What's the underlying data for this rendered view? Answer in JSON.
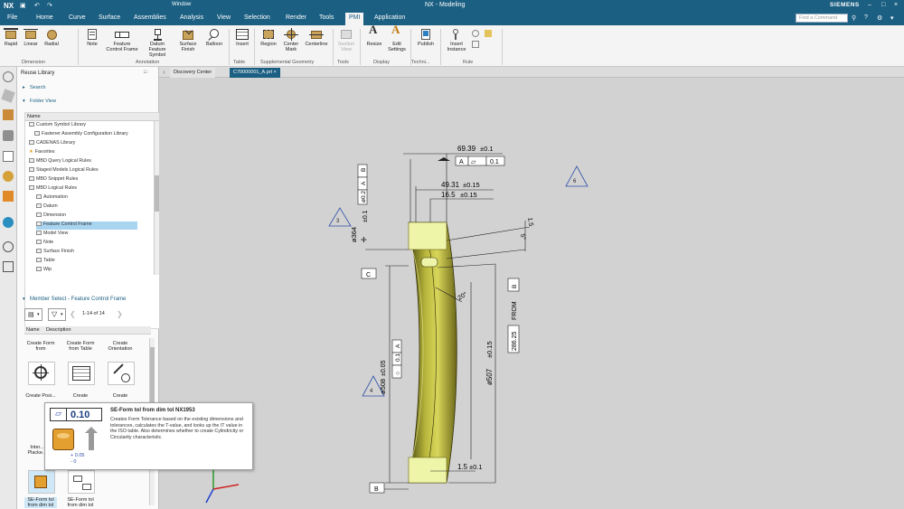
{
  "app": {
    "logo": "NX",
    "window_menu": "Window",
    "title": "NX - Modeling",
    "brand": "SIEMENS",
    "search_placeholder": "Find a Command"
  },
  "menu": [
    "File",
    "Home",
    "Curve",
    "Surface",
    "Assemblies",
    "Analysis",
    "View",
    "Selection",
    "Render",
    "Tools",
    "PMI",
    "Application"
  ],
  "ribbon": {
    "buttons": [
      "Rapid",
      "Linear",
      "Radial",
      "Note",
      "Feature Control Frame",
      "Datum Feature Symbol",
      "Surface Finish",
      "Balloon",
      "Insert",
      "Region",
      "Center Mark",
      "Centerline",
      "Section View",
      "Resize",
      "Edit Settings",
      "Publish",
      "Insert Instance"
    ],
    "groups": [
      "Dimension",
      "Annotation",
      "Table",
      "Supplemental Geometry",
      "Tools",
      "Display",
      "Techni...",
      "Rule"
    ]
  },
  "navigator": {
    "title": "Reuse Library",
    "search_label": "Search",
    "folder_view_label": "Folder View",
    "column_name": "Name",
    "tree": [
      "Custom Symbol Library",
      "Fastener Assembly Configuration Library",
      "CADENAS Library",
      "Favorites",
      "MBD Query Logical Rules",
      "Staged Models Logical Rules",
      "MBD Snippet Rules",
      "MBD Logical Rules",
      "Automation",
      "Datum",
      "Dimension",
      "Feature Control Frame",
      "Model View",
      "Note",
      "Surface Finish",
      "Table",
      "Wip"
    ],
    "member_select_label": "Member Select - Feature Control Frame",
    "page_count": "1-14 of 14",
    "col_name": "Name",
    "col_desc": "Description",
    "members_row1": [
      "Create Form from",
      "Create Form from Table",
      "Create Orientation"
    ],
    "members_row2": [
      "Create Posi...",
      "Create",
      "Create"
    ],
    "members_row3": [
      "Inter... Placke..."
    ],
    "members_row4": [
      "SE-Form tol from dim tol",
      "SE-Form tol from dim tol"
    ]
  },
  "tabs": [
    "Discovery Center",
    "C70000001_A.prt"
  ],
  "tooltip": {
    "title": "SE-Form tol from dim tol NX1953",
    "frame_value": "0.10",
    "tol_plus": "+ 0.05",
    "tol_minus": "- 0",
    "body": "Creates Form Tolerance based on the existing dimensions and tolerances, calculates the T-value, and looks up the IT value in the ISO table. Also determines whether to create Cylindricity or Circularity characteristic."
  },
  "drawing": {
    "dims": {
      "d69": "69.39",
      "tol_01": "±0.1",
      "datum_A": "A",
      "fcf_val": "0.1",
      "d4931": "49.31",
      "d165": "16.5",
      "tol_015": "±0.15",
      "d15": "1.5",
      "angle5": "5°",
      "angle20": "20°",
      "d5": "5",
      "datum_C": "C",
      "datum_B": "B",
      "d2862": "286.25",
      "from": "FROM",
      "d507": "ø507",
      "d364": "ø364",
      "d02": "ø0.2",
      "d508": "ø508",
      "tol_005": "±0.05",
      "vert_01": "0.1",
      "vert_A": "A",
      "vert_B": "B",
      "badge6": "6",
      "badge3": "3",
      "badge4": "4"
    }
  },
  "colors": {
    "titlebar": "#1b5f82",
    "part": "#c8c64a",
    "part_dark": "#6b6618",
    "part_highlight": "#eef5a8",
    "annotation_blue": "#2d4fa8"
  }
}
